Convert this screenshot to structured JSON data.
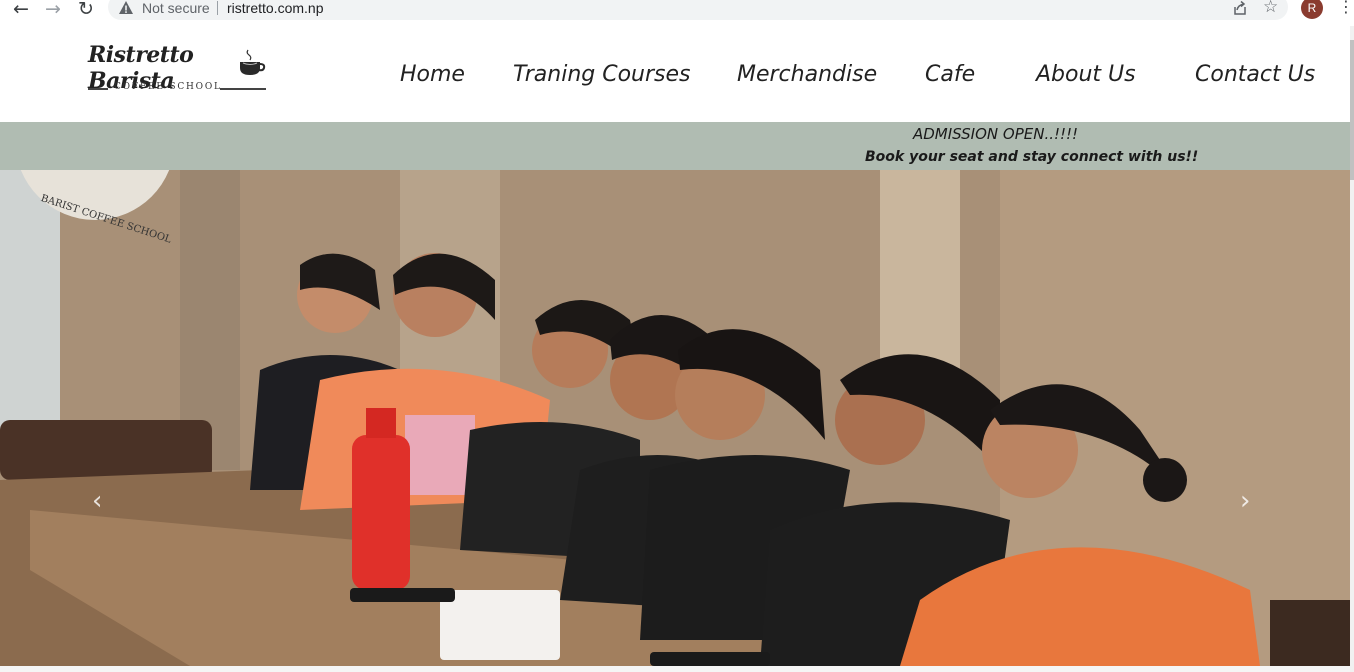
{
  "browser": {
    "back_icon": "←",
    "forward_icon": "→",
    "reload_icon": "↻",
    "security_label": "Not secure",
    "url": "ristretto.com.np",
    "star_icon": "☆",
    "avatar_letter": "R",
    "menu_icon": "⋮"
  },
  "logo": {
    "script_text": "Ristretto Barista",
    "subtitle": "COFFEE SCHOOL"
  },
  "nav": {
    "items": [
      "Home",
      "Traning Courses",
      "Merchandise",
      "Cafe",
      "About Us",
      "Contact Us"
    ]
  },
  "banner": {
    "line1": "ADMISSION OPEN..!!!!",
    "line2": "Book your seat and stay connect with us!!"
  },
  "hero": {
    "badge_text": "BARIST COFFEE SCHOOL",
    "prev_icon": "‹",
    "next_icon": "›"
  },
  "colors": {
    "banner_bg": "#b0bcb2",
    "nav_text": "#222222"
  }
}
